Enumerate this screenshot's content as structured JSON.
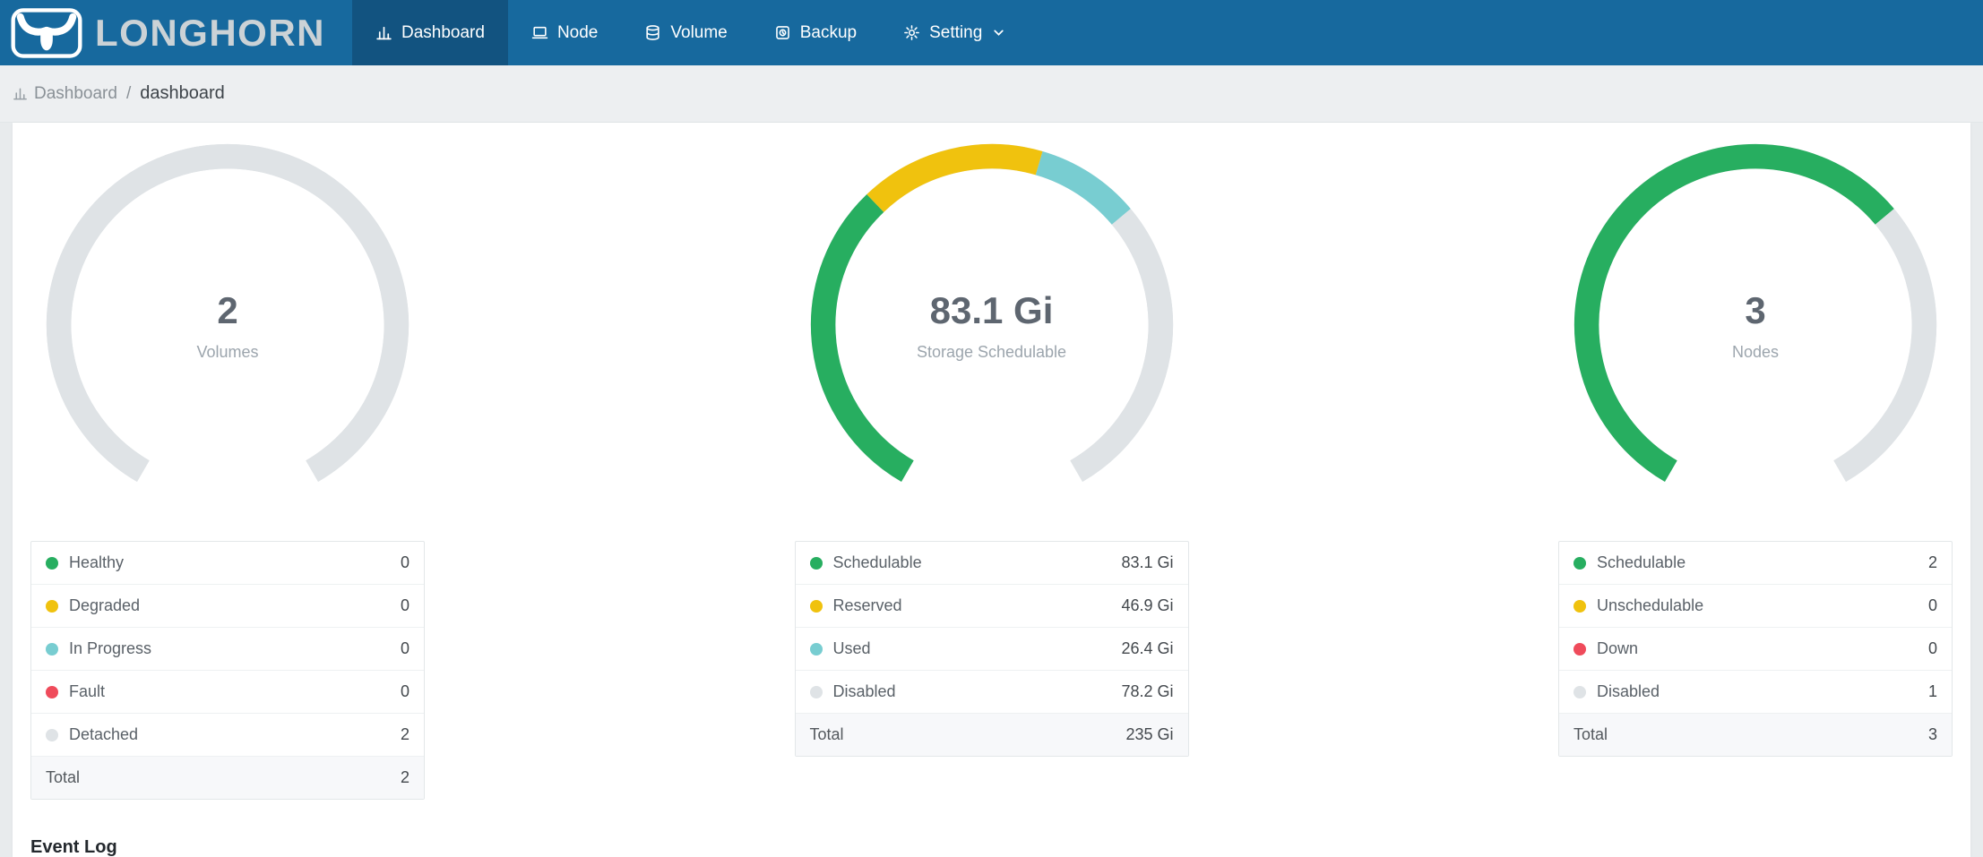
{
  "header": {
    "brand": "LONGHORN",
    "nav": [
      {
        "label": "Dashboard",
        "icon": "dashboard-icon",
        "active": true,
        "has_dropdown": false
      },
      {
        "label": "Node",
        "icon": "node-icon",
        "active": false,
        "has_dropdown": false
      },
      {
        "label": "Volume",
        "icon": "volume-icon",
        "active": false,
        "has_dropdown": false
      },
      {
        "label": "Backup",
        "icon": "backup-icon",
        "active": false,
        "has_dropdown": false
      },
      {
        "label": "Setting",
        "icon": "setting-icon",
        "active": false,
        "has_dropdown": true
      }
    ],
    "colors": {
      "bar": "#17699E",
      "active_tab": "#125380"
    }
  },
  "breadcrumb": {
    "icon": "bar-chart-icon",
    "section": "Dashboard",
    "separator": "/",
    "page": "dashboard"
  },
  "event_log_title": "Event Log",
  "chart_data": [
    {
      "type": "gauge",
      "center_value": "2",
      "center_label": "Volumes",
      "arc": {
        "start_deg": 120,
        "sweep_deg": 300,
        "track_color": "#DFE3E6"
      },
      "segments": [
        {
          "label": "Healthy",
          "color": "#27AE60",
          "value": 0,
          "display": "0"
        },
        {
          "label": "Degraded",
          "color": "#F0C20E",
          "value": 0,
          "display": "0"
        },
        {
          "label": "In Progress",
          "color": "#78CDD1",
          "value": 0,
          "display": "0"
        },
        {
          "label": "Fault",
          "color": "#EF4B5B",
          "value": 0,
          "display": "0"
        },
        {
          "label": "Detached",
          "color": "#DFE3E6",
          "value": 2,
          "display": "2"
        }
      ],
      "total": {
        "label": "Total",
        "value": 2,
        "display": "2"
      }
    },
    {
      "type": "gauge",
      "center_value": "83.1 Gi",
      "center_label": "Storage Schedulable",
      "arc": {
        "start_deg": 120,
        "sweep_deg": 300,
        "track_color": "#DFE3E6"
      },
      "segments": [
        {
          "label": "Schedulable",
          "color": "#27AE60",
          "value": 83.1,
          "display": "83.1 Gi"
        },
        {
          "label": "Reserved",
          "color": "#F0C20E",
          "value": 46.9,
          "display": "46.9 Gi"
        },
        {
          "label": "Used",
          "color": "#78CDD1",
          "value": 26.4,
          "display": "26.4 Gi"
        },
        {
          "label": "Disabled",
          "color": "#DFE3E6",
          "value": 78.2,
          "display": "78.2 Gi"
        }
      ],
      "total": {
        "label": "Total",
        "value": 235,
        "display": "235 Gi"
      }
    },
    {
      "type": "gauge",
      "center_value": "3",
      "center_label": "Nodes",
      "arc": {
        "start_deg": 120,
        "sweep_deg": 300,
        "track_color": "#DFE3E6"
      },
      "segments": [
        {
          "label": "Schedulable",
          "color": "#27AE60",
          "value": 2,
          "display": "2"
        },
        {
          "label": "Unschedulable",
          "color": "#F0C20E",
          "value": 0,
          "display": "0"
        },
        {
          "label": "Down",
          "color": "#EF4B5B",
          "value": 0,
          "display": "0"
        },
        {
          "label": "Disabled",
          "color": "#DFE3E6",
          "value": 1,
          "display": "1"
        }
      ],
      "total": {
        "label": "Total",
        "value": 3,
        "display": "3"
      }
    }
  ]
}
